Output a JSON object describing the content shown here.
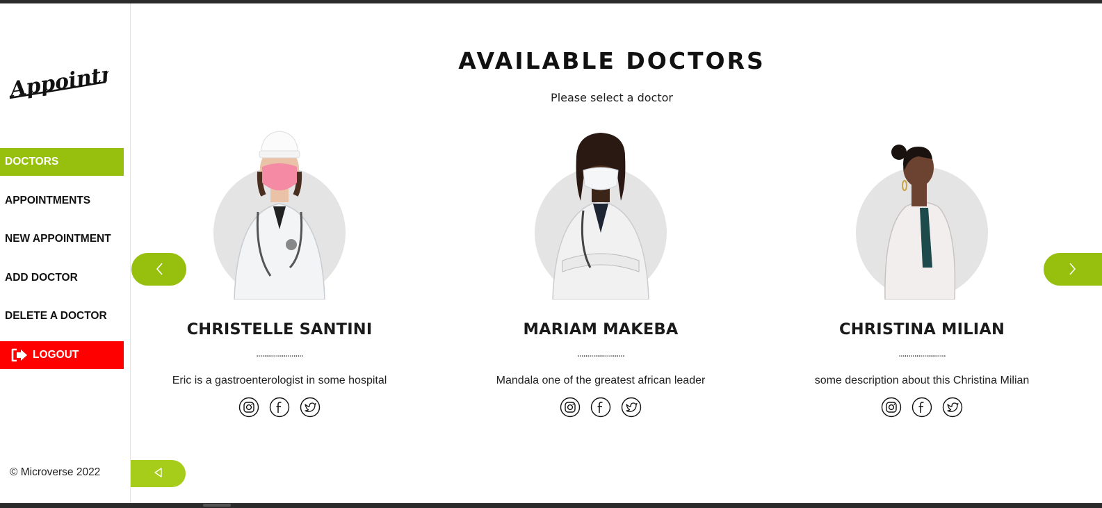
{
  "sidebar": {
    "logo_text": "Appointment",
    "nav": [
      {
        "label": "DOCTORS",
        "active": true
      },
      {
        "label": "APPOINTMENTS"
      },
      {
        "label": "NEW APPOINTMENT"
      },
      {
        "label": "ADD DOCTOR"
      },
      {
        "label": "DELETE A DOCTOR"
      }
    ],
    "logout_label": "LOGOUT",
    "copyright": "© Microverse 2022"
  },
  "main": {
    "title": "AVAILABLE DOCTORS",
    "subtitle": "Please select a doctor",
    "doctors": [
      {
        "name": "CHRISTELLE SANTINI",
        "separator": "........................",
        "description": "Eric is a gastroenterologist in some hospital"
      },
      {
        "name": "MARIAM MAKEBA",
        "separator": "........................",
        "description": "Mandala one of the greatest african leader"
      },
      {
        "name": "CHRISTINA MILIAN",
        "separator": "........................",
        "description": "some description about this Christina Milian"
      }
    ],
    "social_icons": [
      "instagram-icon",
      "facebook-icon",
      "twitter-icon"
    ]
  },
  "colors": {
    "accent": "#97c00e",
    "logout": "#ff0000",
    "circle_bg": "#e4e4e4"
  }
}
